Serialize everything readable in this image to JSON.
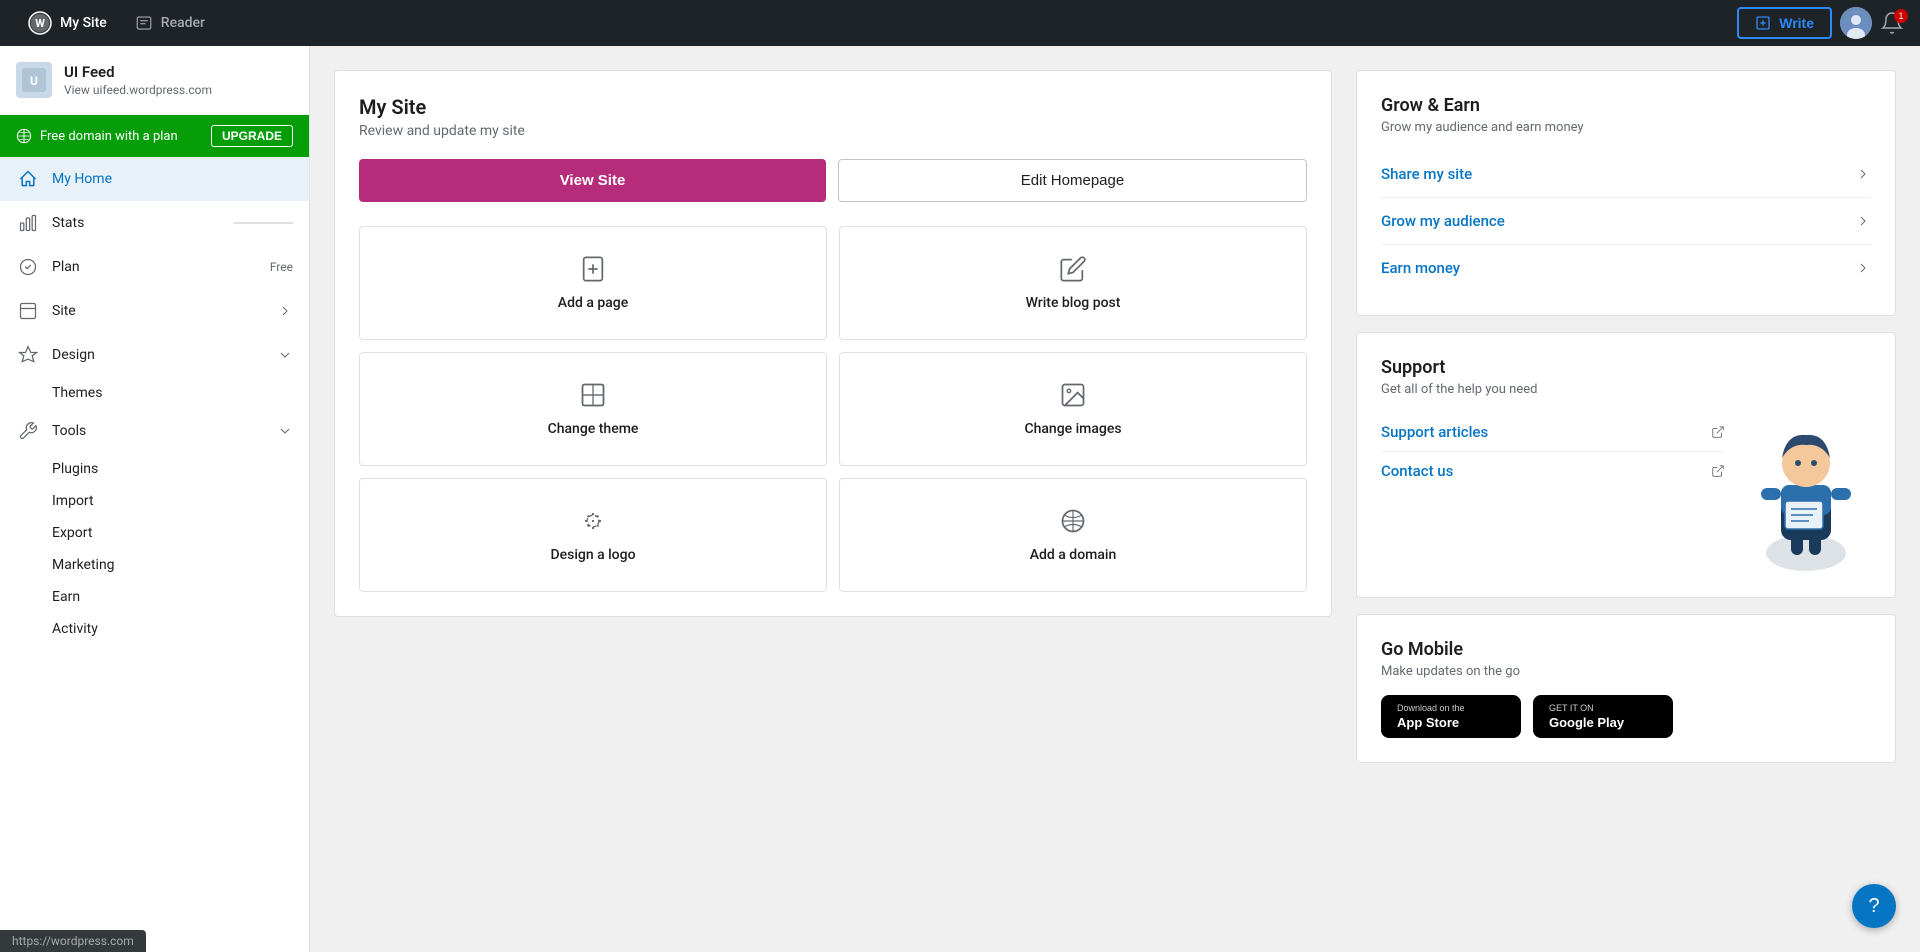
{
  "topnav": {
    "my_site_label": "My Site",
    "reader_label": "Reader",
    "write_label": "Write",
    "notif_count": "1"
  },
  "sidebar": {
    "site_name": "UI Feed",
    "site_url": "View uifeed.wordpress.com",
    "upgrade_banner": {
      "text": "Free domain with a plan",
      "button": "UPGRADE"
    },
    "nav_items": [
      {
        "id": "my-home",
        "label": "My Home",
        "active": true
      },
      {
        "id": "stats",
        "label": "Stats"
      },
      {
        "id": "plan",
        "label": "Plan",
        "badge": "Free"
      },
      {
        "id": "site",
        "label": "Site",
        "has_chevron": true,
        "expanded": false
      },
      {
        "id": "design",
        "label": "Design",
        "has_chevron": true,
        "expanded": true
      },
      {
        "id": "tools",
        "label": "Tools",
        "has_chevron": true,
        "expanded": true
      }
    ],
    "design_sub": [
      "Themes"
    ],
    "tools_sub": [
      "Plugins",
      "Import",
      "Export",
      "Marketing",
      "Earn",
      "Activity"
    ]
  },
  "main": {
    "site_section": {
      "title": "My Site",
      "subtitle": "Review and update my site",
      "view_site_btn": "View Site",
      "edit_homepage_btn": "Edit Homepage",
      "tiles": [
        {
          "id": "add-page",
          "label": "Add a page"
        },
        {
          "id": "write-blog-post",
          "label": "Write blog post"
        },
        {
          "id": "change-theme",
          "label": "Change theme"
        },
        {
          "id": "change-images",
          "label": "Change images"
        },
        {
          "id": "design-logo",
          "label": "Design a logo"
        },
        {
          "id": "add-domain",
          "label": "Add a domain"
        }
      ]
    },
    "grow_earn": {
      "title": "Grow & Earn",
      "subtitle": "Grow my audience and earn money",
      "links": [
        {
          "id": "share-my-site",
          "label": "Share my site"
        },
        {
          "id": "grow-my-audience",
          "label": "Grow my audience"
        },
        {
          "id": "earn-money",
          "label": "Earn money"
        }
      ]
    },
    "support": {
      "title": "Support",
      "subtitle": "Get all of the help you need",
      "links": [
        {
          "id": "support-articles",
          "label": "Support articles",
          "external": true
        },
        {
          "id": "contact-us",
          "label": "Contact us",
          "external": true
        }
      ]
    },
    "go_mobile": {
      "title": "Go Mobile",
      "subtitle": "Make updates on the go",
      "app_store_label": "Download on the",
      "app_store_name": "App Store",
      "google_play_label": "GET IT ON",
      "google_play_name": "Google Play"
    }
  },
  "status_bar": {
    "url": "https://wordpress.com"
  }
}
